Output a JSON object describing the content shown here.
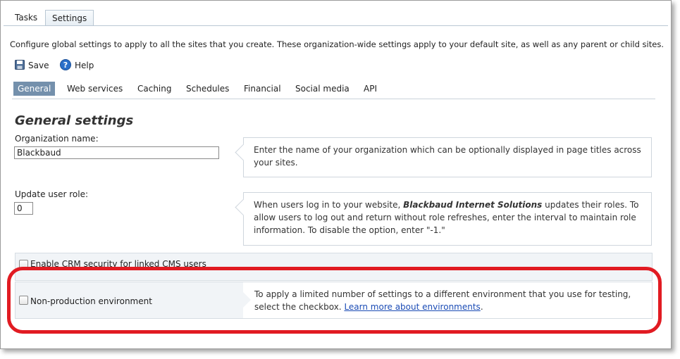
{
  "tabs": {
    "tasks": "Tasks",
    "settings": "Settings"
  },
  "description": "Configure global settings to apply to all the sites that you create. These organization-wide settings apply to your default site, as well as any parent or child sites.",
  "toolbar": {
    "save": "Save",
    "help": "Help"
  },
  "subtabs": [
    "General",
    "Web services",
    "Caching",
    "Schedules",
    "Financial",
    "Social media",
    "API"
  ],
  "heading": "General settings",
  "org_name": {
    "label": "Organization name:",
    "value": "Blackbaud",
    "help": "Enter the name of your organization which can be optionally displayed in page titles across your sites."
  },
  "user_role": {
    "label": "Update user role:",
    "value": "0",
    "help_pre": "When users log in to your website, ",
    "help_bold": "Blackbaud Internet Solutions",
    "help_post": " updates their roles. To allow users to log out and return without role refreshes, enter the interval to maintain role information. To disable the option, enter \"-1.\""
  },
  "crm_security": {
    "label": "Enable CRM security for linked CMS users"
  },
  "non_production": {
    "label": "Non-production environment",
    "help_pre": "To apply a limited number of settings to a different environment that you use for testing, select the checkbox. ",
    "help_link": "Learn more about environments",
    "help_post": "."
  },
  "colors": {
    "active_tab": "#7490ac",
    "highlight": "#e11b22",
    "link": "#1a4bb5"
  }
}
